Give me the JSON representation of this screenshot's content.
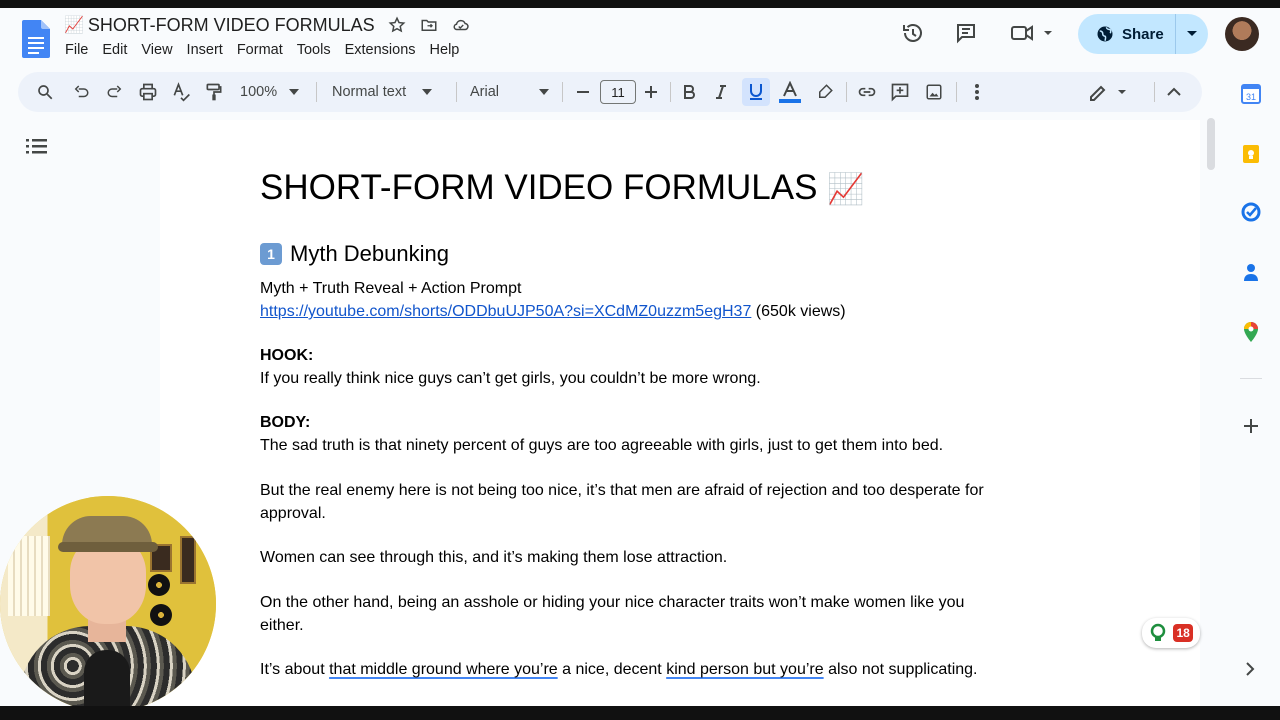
{
  "app": {
    "title_emoji": "📈",
    "title": "SHORT-FORM VIDEO FORMULAS"
  },
  "menu": [
    "File",
    "Edit",
    "View",
    "Insert",
    "Format",
    "Tools",
    "Extensions",
    "Help"
  ],
  "header": {
    "share_label": "Share"
  },
  "toolbar": {
    "zoom": "100%",
    "style": "Normal text",
    "font": "Arial",
    "font_size": "11"
  },
  "document": {
    "heading1": "SHORT-FORM VIDEO FORMULAS",
    "heading1_emoji": "📈",
    "section_number": "1",
    "section_title": "Myth Debunking",
    "formula": "Myth + Truth Reveal + Action Prompt",
    "link": "https://youtube.com/shorts/ODDbuUJP50A?si=XCdMZ0uzzm5egH37",
    "views": " (650k views)",
    "hook_label": "HOOK:",
    "hook_text": "If you really think nice guys can’t get girls, you couldn’t be more wrong.",
    "body_label": "BODY:",
    "body_p1": "The sad truth is that ninety percent of guys are too agreeable with girls, just to get them into bed.",
    "body_p2": "But the real enemy here is not being too nice, it’s that men are afraid of rejection and too desperate for approval.",
    "body_p3": "Women can see through this, and it’s making them lose attraction.",
    "body_p4": "On the other hand, being an asshole or hiding your nice character traits won’t make women like you either.",
    "body_p5_a": "It’s about ",
    "body_p5_b": "that middle ground where you’re",
    "body_p5_c": " a nice, decent ",
    "body_p5_d": "kind person but you’re",
    "body_p5_e": " also not supplicating."
  },
  "badge": {
    "count": "18"
  },
  "colors": {
    "accent": "#c2e7ff",
    "link": "#1155cc",
    "badge": "#d93025"
  }
}
